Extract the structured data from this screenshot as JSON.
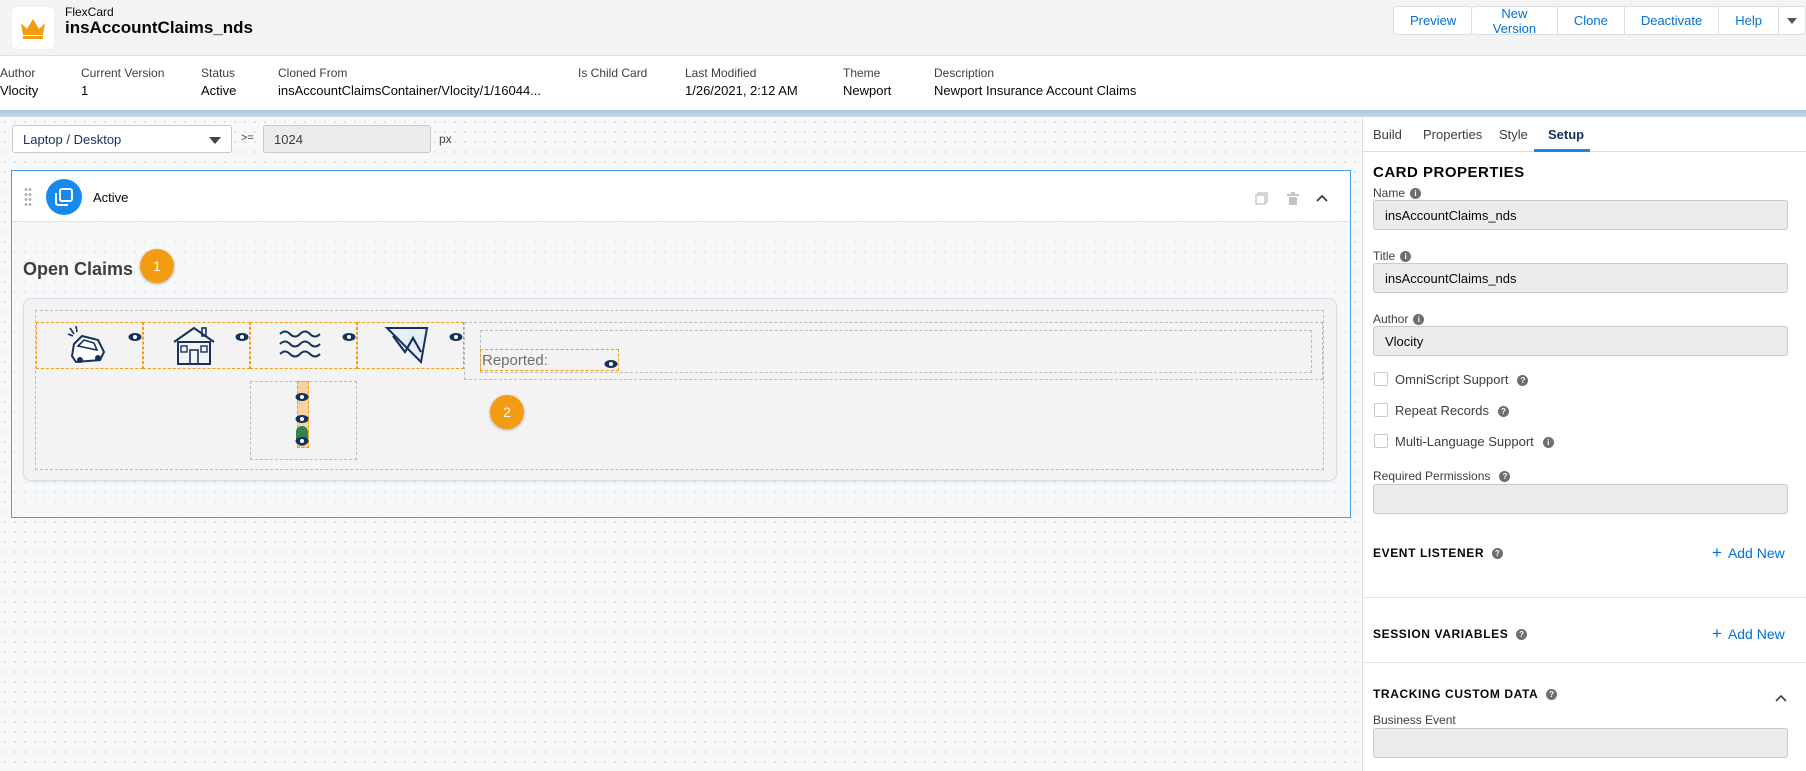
{
  "header": {
    "subtitle": "FlexCard",
    "title": "insAccountClaims_nds",
    "buttons": [
      "Preview",
      "New Version",
      "Clone",
      "Deactivate",
      "Help"
    ]
  },
  "meta": [
    {
      "label": "Author",
      "value": "Vlocity"
    },
    {
      "label": "Current Version",
      "value": "1"
    },
    {
      "label": "Status",
      "value": "Active"
    },
    {
      "label": "Cloned From",
      "value": "insAccountClaimsContainer/Vlocity/1/16044..."
    },
    {
      "label": "Is Child Card",
      "value": ""
    },
    {
      "label": "Last Modified",
      "value": "1/26/2021, 2:12 AM"
    },
    {
      "label": "Theme",
      "value": "Newport"
    },
    {
      "label": "Description",
      "value": "Newport Insurance Account Claims"
    }
  ],
  "canvas": {
    "device": "Laptop / Desktop",
    "comparator": ">=",
    "width_value": "1024",
    "unit": "px",
    "state_name": "Active",
    "card_title": "Open Claims",
    "badge_1": "1",
    "badge_2": "2",
    "reported_label": "Reported:"
  },
  "panel": {
    "tabs": [
      "Build",
      "Properties",
      "Style",
      "Setup"
    ],
    "active_tab": "Setup",
    "section_title": "CARD PROPERTIES",
    "name_label": "Name",
    "name_value": "insAccountClaims_nds",
    "title_label": "Title",
    "title_value": "insAccountClaims_nds",
    "author_label": "Author",
    "author_value": "Vlocity",
    "omniscript_label": "OmniScript Support",
    "repeat_label": "Repeat Records",
    "multilang_label": "Multi-Language Support",
    "permissions_label": "Required Permissions",
    "event_listener": "EVENT LISTENER",
    "session_variables": "SESSION VARIABLES",
    "add_new": "Add New",
    "tracking": "TRACKING CUSTOM DATA",
    "business_event_label": "Business Event"
  },
  "colors": {
    "accent": "#1589ee",
    "link": "#0070d2",
    "badge": "#f39c12",
    "crown": "#f39c12"
  }
}
